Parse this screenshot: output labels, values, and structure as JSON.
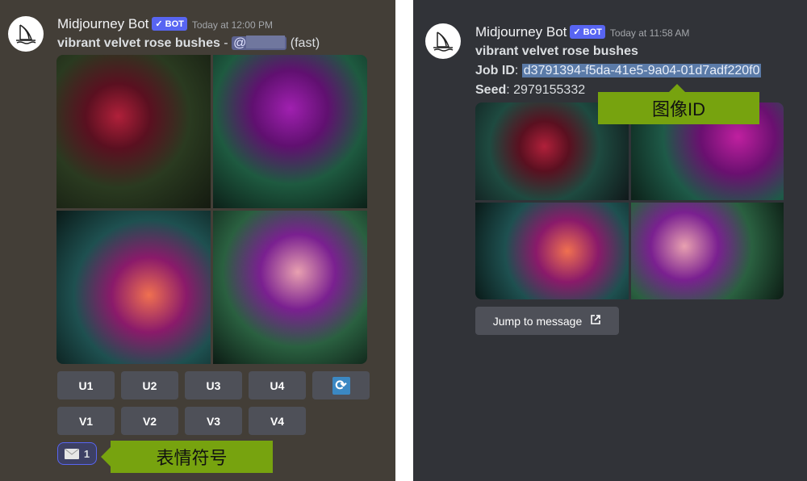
{
  "left": {
    "author": "Midjourney Bot",
    "badge": "✓ BOT",
    "timestamp": "Today at 12:00 PM",
    "prompt": "vibrant velvet rose bushes",
    "separator": " - ",
    "mention": "@",
    "mode": "(fast)",
    "buttons_u": [
      "U1",
      "U2",
      "U3",
      "U4"
    ],
    "buttons_v": [
      "V1",
      "V2",
      "V3",
      "V4"
    ],
    "reroll_icon": "refresh-icon",
    "reaction": {
      "icon": "envelope-icon",
      "count": "1"
    },
    "callout": "表情符号"
  },
  "right": {
    "author": "Midjourney Bot",
    "badge": "✓ BOT",
    "timestamp": "Today at 11:58 AM",
    "prompt": "vibrant velvet rose bushes",
    "job_id_label": "Job ID",
    "job_id": "d3791394-f5da-41e5-9a04-01d7adf220f0",
    "seed_label": "Seed",
    "seed": "2979155332",
    "callout": "图像ID",
    "jump_label": "Jump to message",
    "jump_icon": "external-link-icon"
  },
  "colors": {
    "accent": "#5865f2",
    "callout": "#77a30f",
    "left_bg": "#433e37",
    "right_bg": "#313338"
  }
}
